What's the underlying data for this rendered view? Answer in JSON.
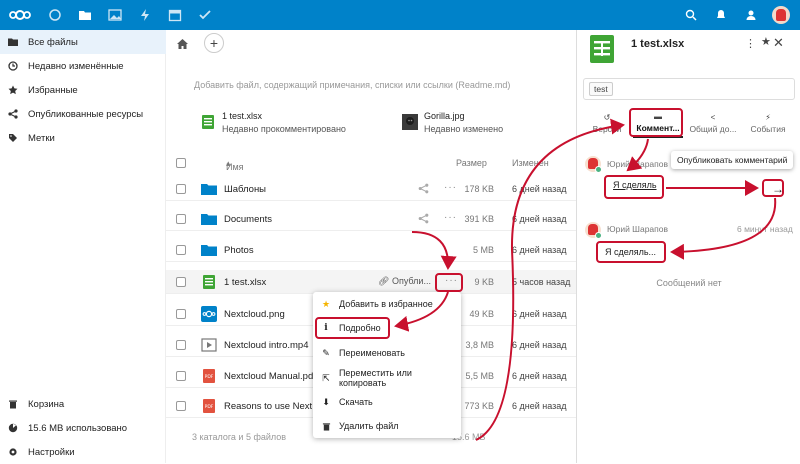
{
  "topbar": {
    "apps": [
      "files-icon",
      "photos-icon",
      "activity-icon",
      "calendar-icon",
      "tasks-icon"
    ],
    "right_icons": [
      "search-icon",
      "notifications-icon",
      "contacts-icon"
    ],
    "brand_color": "#0082c9"
  },
  "sidebar": {
    "items": [
      {
        "label": "Все файлы",
        "icon": "folder-icon"
      },
      {
        "label": "Недавно изменённые",
        "icon": "clock-icon"
      },
      {
        "label": "Избранные",
        "icon": "star-icon"
      },
      {
        "label": "Опубликованные ресурсы",
        "icon": "share-icon"
      },
      {
        "label": "Метки",
        "icon": "tag-icon"
      }
    ],
    "bottom": [
      {
        "label": "Корзина",
        "icon": "trash-icon"
      },
      {
        "label": "15.6 MB использовано",
        "icon": "pie-icon"
      },
      {
        "label": "Настройки",
        "icon": "gear-icon"
      }
    ]
  },
  "main": {
    "readme_hint": "Добавить файл, содержащий примечания, списки или ссылки (Readme.md)",
    "recent": [
      {
        "name": "1 test.xlsx",
        "desc": "Недавно прокомментировано"
      },
      {
        "name": "Gorilla.jpg",
        "desc": "Недавно изменено"
      }
    ],
    "columns": {
      "name": "Имя",
      "size": "Размер",
      "modified": "Изменен"
    },
    "files": [
      {
        "name": "Шаблоны",
        "type": "folder",
        "size": "178 KB",
        "modified": "6 дней назад"
      },
      {
        "name": "Documents",
        "type": "folder",
        "size": "391 KB",
        "modified": "6 дней назад"
      },
      {
        "name": "Photos",
        "type": "folder",
        "size": "5 MB",
        "modified": "6 дней назад"
      },
      {
        "name": "1 test.xlsx",
        "type": "sheet",
        "size": "9 KB",
        "modified": "5 часов назад",
        "share_label": "Опубли..."
      },
      {
        "name": "Nextcloud.png",
        "type": "image",
        "size": "49 KB",
        "modified": "6 дней назад"
      },
      {
        "name": "Nextcloud intro.mp4",
        "type": "video",
        "size": "3,8 MB",
        "modified": "6 дней назад"
      },
      {
        "name": "Nextcloud Manual.pdf",
        "type": "pdf",
        "size": "5,5 MB",
        "modified": "6 дней назад"
      },
      {
        "name": "Reasons to use Nextcloud.pdf",
        "type": "pdf",
        "size": "773 KB",
        "modified": "6 дней назад"
      }
    ],
    "summary": "3 каталога и 5 файлов",
    "summary_size": "15.6 MB"
  },
  "context_menu": [
    {
      "label": "Добавить в избранное",
      "icon": "star-icon"
    },
    {
      "label": "Подробно",
      "icon": "info-icon"
    },
    {
      "label": "Переименовать",
      "icon": "pencil-icon"
    },
    {
      "label": "Переместить или копировать",
      "icon": "move-icon"
    },
    {
      "label": "Скачать",
      "icon": "download-icon"
    },
    {
      "label": "Удалить файл",
      "icon": "trash-icon"
    }
  ],
  "panel": {
    "title": "1 test.xlsx",
    "tag": "test",
    "tabs": [
      {
        "label": "Версии",
        "icon": "history-icon"
      },
      {
        "label": "Коммент...",
        "icon": "comment-icon"
      },
      {
        "label": "Общий до...",
        "icon": "share-icon"
      },
      {
        "label": "События",
        "icon": "activity-icon"
      }
    ],
    "new_comment_author": "Юрий Шарапов",
    "new_comment_text": "Я сделяль",
    "tooltip": "Опубликовать комментарий",
    "comment": {
      "author": "Юрий Шарапов",
      "time": "6 минут назад",
      "text": "Я сделяль..."
    },
    "no_more": "Сообщений нет"
  },
  "annotation_color": "#c8102e"
}
